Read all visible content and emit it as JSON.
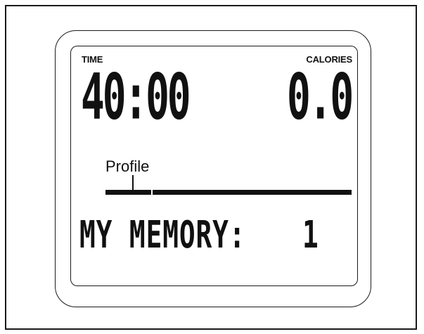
{
  "console": {
    "time": {
      "label": "TIME",
      "value": "40:00"
    },
    "calories": {
      "label": "CALORIES",
      "value": "0.0"
    },
    "profile": {
      "label": "Profile"
    },
    "memory": {
      "label": "MY MEMORY:",
      "value": "1"
    }
  }
}
